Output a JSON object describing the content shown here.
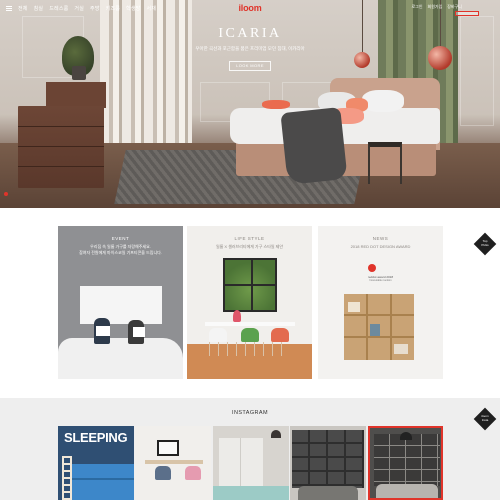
{
  "header": {
    "logo": "iloom",
    "nav": [
      "전체",
      "침실",
      "드레스룸",
      "거실",
      "주방",
      "키즈룸",
      "학생방",
      "서재",
      "사무가구",
      "베스트",
      "세일",
      "서비스"
    ],
    "util": [
      "로그인",
      "회원가입",
      "장바구니",
      "고객센터",
      "매장찾기"
    ],
    "search_placeholder": ""
  },
  "hero": {
    "title": "ICARIA",
    "subtitle": "우아한 곡선과 포근함을 품은 프리미엄 모던 침대, 이카리아",
    "button_label": "LOOK MORE"
  },
  "promos": {
    "event": {
      "category": "EVENT",
      "line1": "우리집 속 일룸 가구를 자랑해주세요.",
      "line2": "참여자 전원에게 마이스코일 기프티콘을 드립니다."
    },
    "life": {
      "category": "LIFE STYLE",
      "line1": "일룸 X 셀러브리티에게 가구 스타일 제안"
    },
    "news": {
      "category": "NEWS",
      "line1": "2018 RED DOT DESIGN AWARD",
      "badge_line1": "reddot award 2018",
      "badge_line2": "honourable mention"
    },
    "tag_line1": "Top",
    "tag_line2": "Picks"
  },
  "instagram": {
    "title": "INSTAGRAM",
    "tile1_text": "SLEEPING",
    "tag_line1": "iloom",
    "tag_line2": "Insta"
  },
  "colors": {
    "brand_red": "#e0342a",
    "event_gray": "#8f9093",
    "dark_tag": "#1f1f1f",
    "insta_bg": "#eeeeee"
  }
}
